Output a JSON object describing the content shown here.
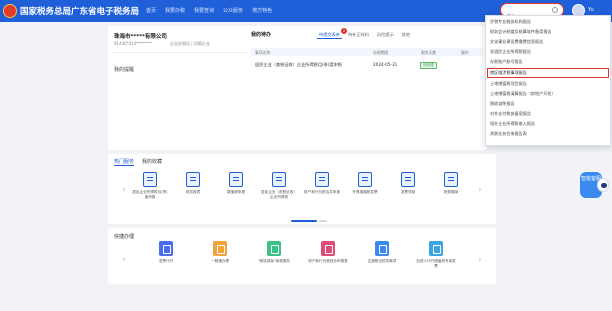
{
  "header": {
    "brand": "国家税务总局广东省电子税务局",
    "nav": [
      "首页",
      "我要办税",
      "我要查询",
      "公众服务",
      "地方特色"
    ],
    "search_value": "报告",
    "user_name": "Yu"
  },
  "company": {
    "name": "珠海市*****有限公司",
    "tax_id": "91440*010********",
    "identity": "企业办税员 | 切换企业",
    "my_reminder": "我的提醒"
  },
  "todo": {
    "title": "我的待办",
    "tabs": [
      {
        "label": "待提交表单",
        "badge": "2"
      },
      {
        "label": "待补正材料"
      },
      {
        "label": "风险提示"
      },
      {
        "label": "其他"
      }
    ],
    "columns": [
      "事项名称",
      "办理期限",
      "剩余天数",
      "操作"
    ],
    "rows": [
      {
        "name": "居民企业（查账征收）企业所得税月(季)度申报",
        "deadline": "2024-05-31",
        "status": "待处理"
      }
    ]
  },
  "dropdown": {
    "items": [
      "涉税专业服务机构报告",
      "财务会计制度及核算软件备案报告",
      "文化事业建设费缴费信息报告",
      "非居民企业所得税报告",
      "存款账户账号报告",
      "跨区域涉税事项报告",
      "土地增值税项目报告",
      "土地增值税清算报告（房地产开发）",
      "税收减免报告",
      "对外支付税务备案报告",
      "境外企业所得税收入报告",
      "关联业务往来报告表"
    ],
    "highlight_index": 5
  },
  "hot_services": {
    "tabs": [
      "热门服务",
      "我的收藏"
    ],
    "items": [
      "居民企业所得税月(季)度申报",
      "财务报表",
      "增值税申报",
      "居民企业（查账征收）企业所得税",
      "财产和行为税合并申报",
      "开具增值税发票",
      "发票领用",
      "税费缴纳"
    ]
  },
  "quick_processing": {
    "title": "快捷办理",
    "items": [
      {
        "label": "发票代开",
        "color": "#4a6cf0"
      },
      {
        "label": "一照通办理",
        "color": "#f2a33a"
      },
      {
        "label": "\"税收减免\"纳税服务",
        "color": "#3cc08a"
      },
      {
        "label": "财产和行为税综合申报表",
        "color": "#e04b7a"
      },
      {
        "label": "注销登记税务事项",
        "color": "#3a8af0"
      },
      {
        "label": "自然人代开增值税专用发票",
        "color": "#3aa6e0"
      }
    ]
  },
  "assistant": {
    "label": "智能客服"
  },
  "colors": {
    "accent": "#1f5fd8",
    "highlight": "#e0352b"
  }
}
